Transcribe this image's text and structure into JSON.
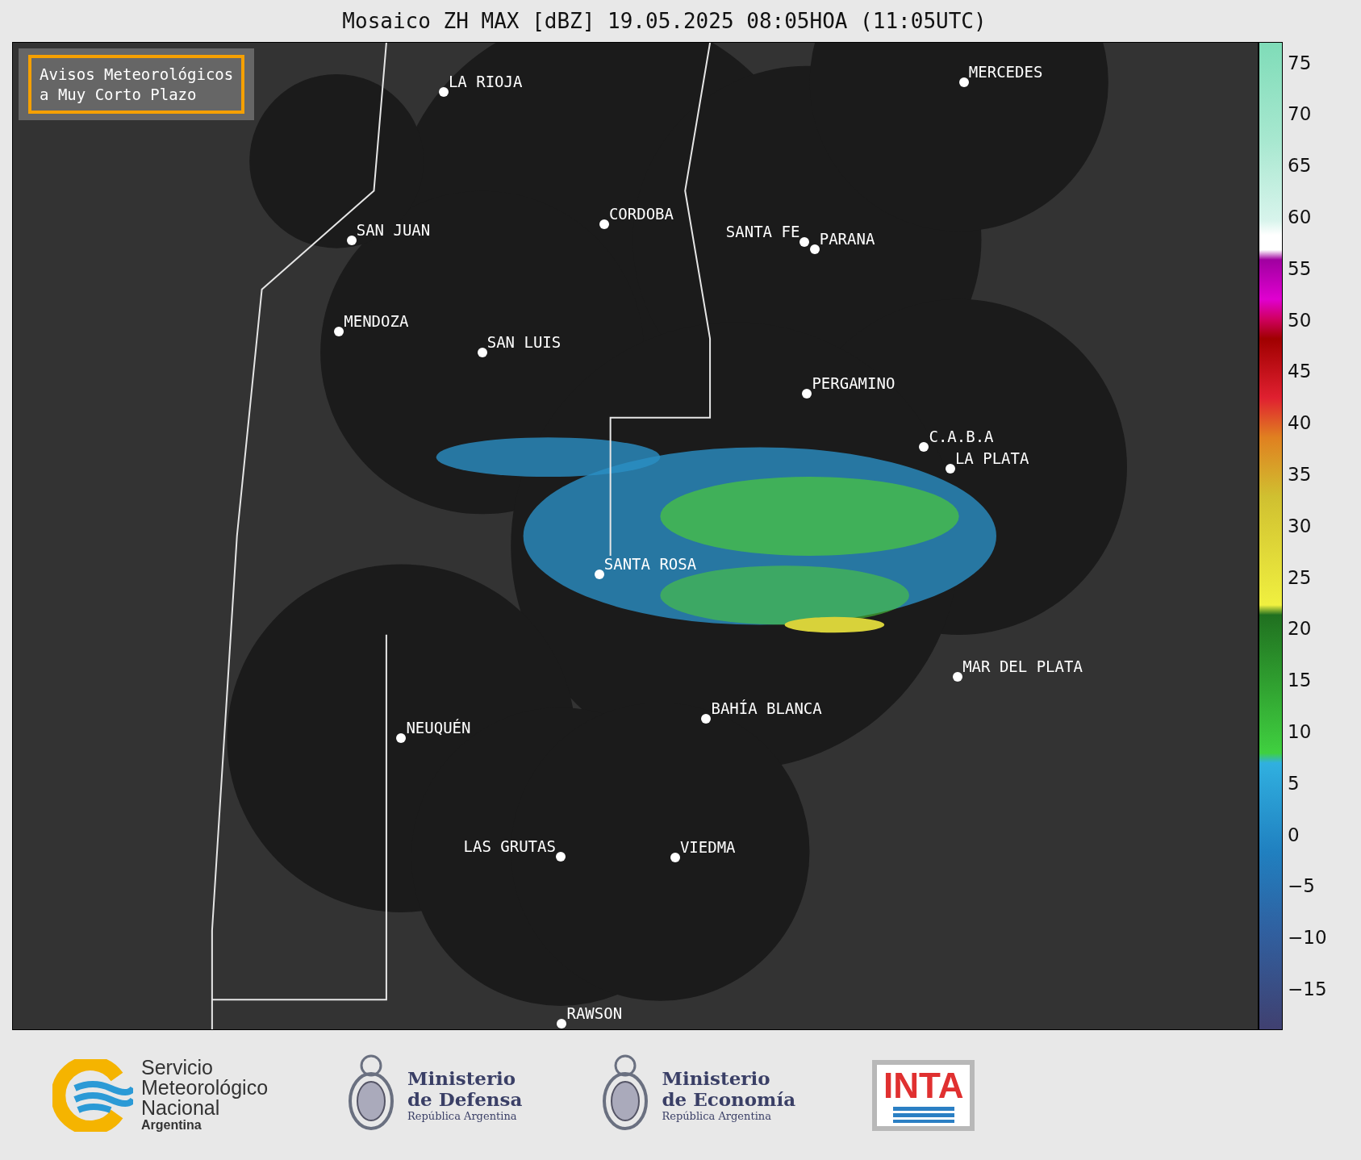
{
  "title": "Mosaico ZH MAX [dBZ] 19.05.2025 08:05HOA (11:05UTC)",
  "legend": {
    "lines": [
      "Avisos Meteorológicos",
      "a Muy Corto Plazo"
    ]
  },
  "cities": [
    {
      "name": "LA RIOJA"
    },
    {
      "name": "MERCEDES"
    },
    {
      "name": "CORDOBA"
    },
    {
      "name": "SAN JUAN"
    },
    {
      "name": "SANTA FE"
    },
    {
      "name": "PARANA"
    },
    {
      "name": "MENDOZA"
    },
    {
      "name": "SAN LUIS"
    },
    {
      "name": "PERGAMINO"
    },
    {
      "name": "C.A.B.A"
    },
    {
      "name": "LA PLATA"
    },
    {
      "name": "SANTA ROSA"
    },
    {
      "name": "MAR DEL PLATA"
    },
    {
      "name": "BAHÍA BLANCA"
    },
    {
      "name": "NEUQUÉN"
    },
    {
      "name": "LAS GRUTAS"
    },
    {
      "name": "VIEDMA"
    },
    {
      "name": "RAWSON"
    }
  ],
  "colorbar": {
    "ticks": [
      "75",
      "70",
      "65",
      "60",
      "55",
      "50",
      "45",
      "40",
      "35",
      "30",
      "25",
      "20",
      "15",
      "10",
      "5",
      "0",
      "−5",
      "−10",
      "−15"
    ]
  },
  "logos": {
    "smn": {
      "lines": [
        "Servicio",
        "Meteorológico",
        "Nacional"
      ],
      "country": "Argentina"
    },
    "defensa": {
      "lines": [
        "Ministerio",
        "de Defensa"
      ],
      "country": "República Argentina"
    },
    "economia": {
      "lines": [
        "Ministerio",
        "de Economía"
      ],
      "country": "República Argentina"
    },
    "inta": {
      "text": "INTA"
    }
  }
}
